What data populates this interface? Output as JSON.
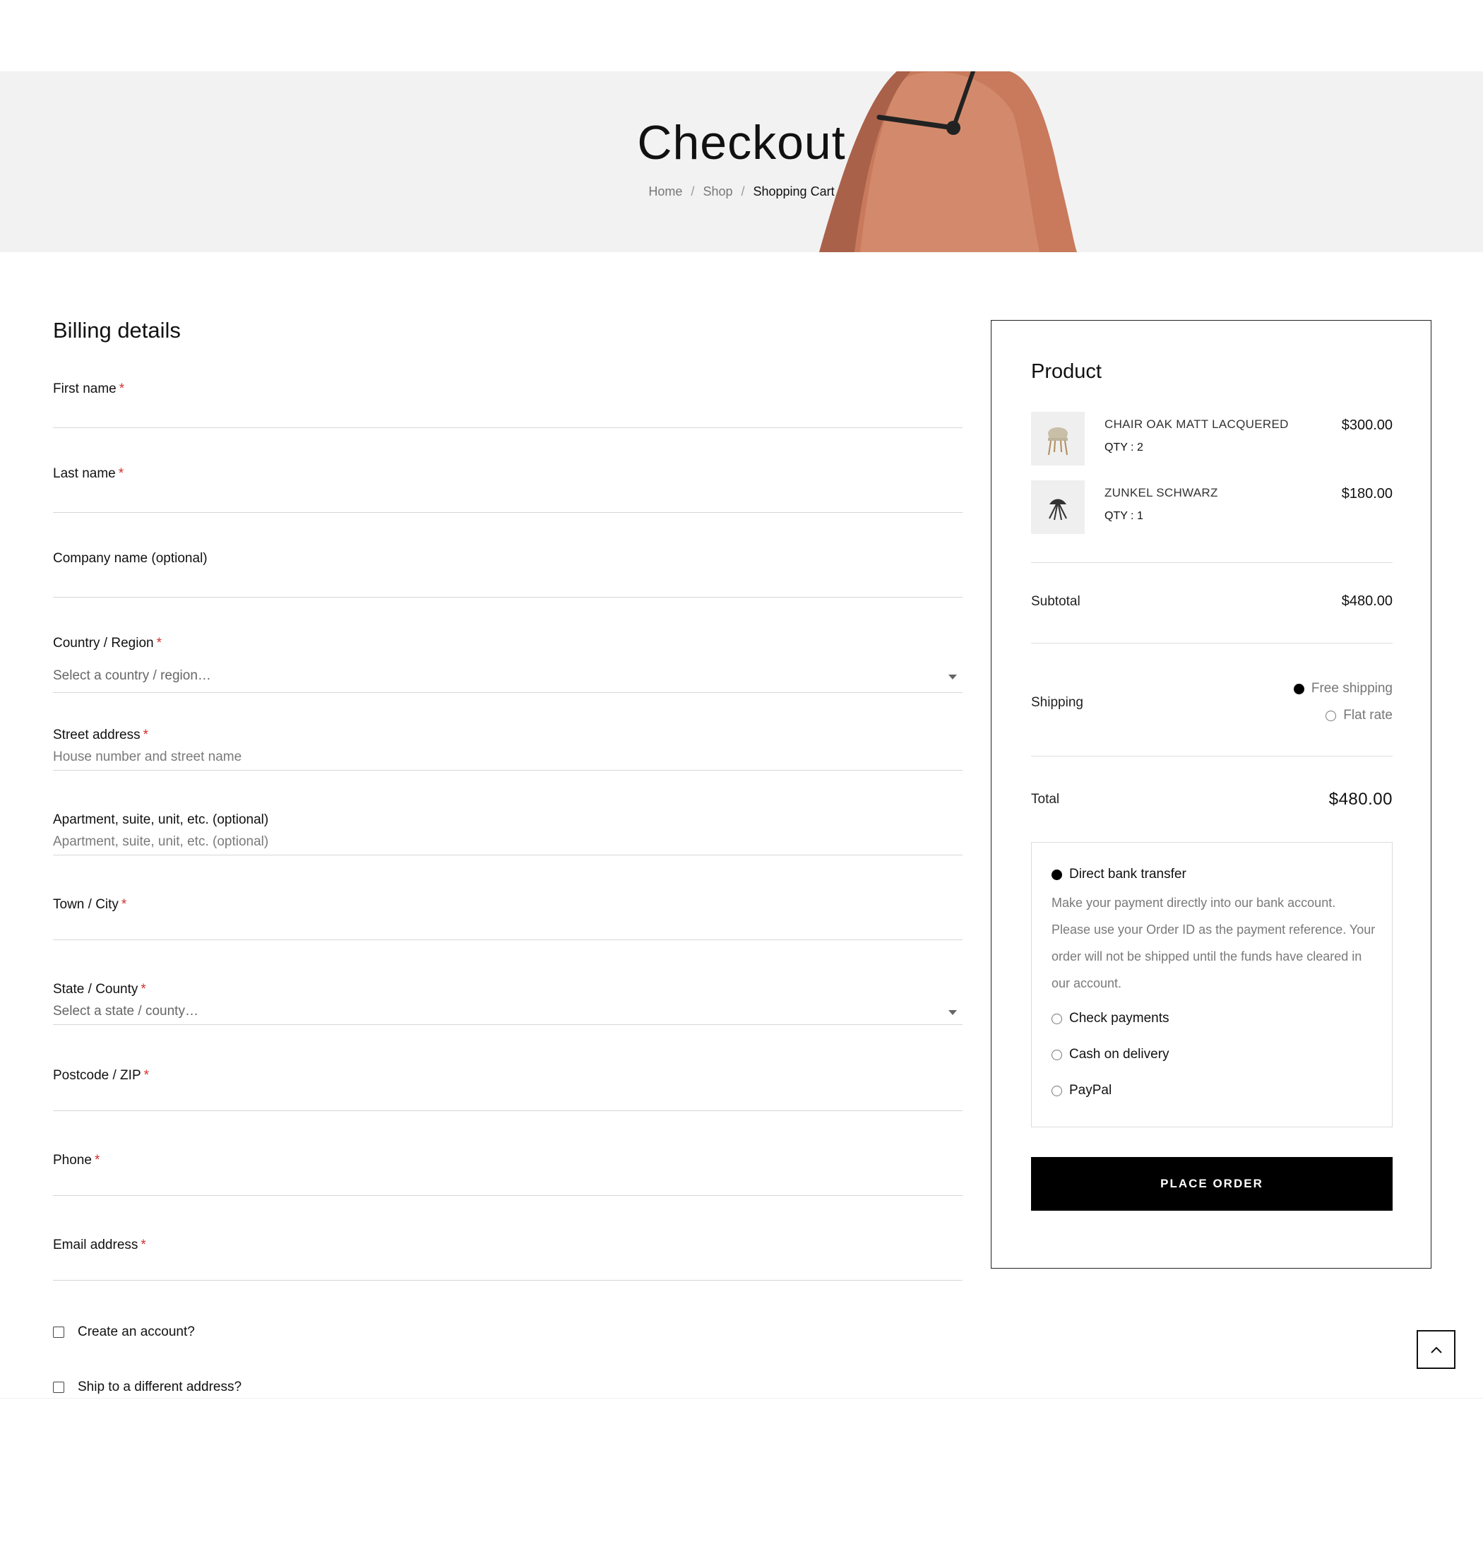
{
  "hero": {
    "title": "Checkout",
    "breadcrumb": [
      {
        "label": "Home"
      },
      {
        "label": "Shop"
      },
      {
        "label": "Shopping Cart"
      }
    ],
    "separator": "/"
  },
  "billing": {
    "heading": "Billing details",
    "fields": {
      "first_name": {
        "label": "First name",
        "required": "*",
        "value": ""
      },
      "last_name": {
        "label": "Last name",
        "required": "*",
        "value": ""
      },
      "company": {
        "label": "Company name (optional)",
        "value": ""
      },
      "country": {
        "label": "Country / Region",
        "required": "*",
        "selected": "Select a country / region…"
      },
      "street": {
        "label": "Street address",
        "required": "*",
        "placeholder": "House number and street name"
      },
      "apartment": {
        "label": "Apartment, suite, unit, etc. (optional)",
        "placeholder": "Apartment, suite, unit, etc. (optional)"
      },
      "city": {
        "label": "Town / City",
        "required": "*",
        "value": ""
      },
      "state": {
        "label": "State / County",
        "required": "*",
        "selected": "Select a state / county…"
      },
      "postcode": {
        "label": "Postcode / ZIP",
        "required": "*",
        "value": ""
      },
      "phone": {
        "label": "Phone",
        "required": "*",
        "value": ""
      },
      "email": {
        "label": "Email address",
        "required": "*",
        "value": ""
      }
    },
    "create_account": "Create an account?",
    "ship_different": "Ship to a different address?"
  },
  "order": {
    "heading": "Product",
    "items": [
      {
        "name": "CHAIR OAK MATT LACQUERED",
        "qty": "QTY : 2",
        "price": "$300.00",
        "icon": "chair-icon"
      },
      {
        "name": "ZUNKEL SCHWARZ",
        "qty": "QTY : 1",
        "price": "$180.00",
        "icon": "stool-icon"
      }
    ],
    "subtotal_label": "Subtotal",
    "subtotal_value": "$480.00",
    "shipping_label": "Shipping",
    "shipping_options": [
      {
        "label": "Free shipping",
        "selected": true
      },
      {
        "label": "Flat rate",
        "selected": false
      }
    ],
    "total_label": "Total",
    "total_value": "$480.00",
    "payment_methods": [
      {
        "label": "Direct bank transfer",
        "selected": true
      },
      {
        "label": "Check payments",
        "selected": false
      },
      {
        "label": "Cash on delivery",
        "selected": false
      },
      {
        "label": "PayPal",
        "selected": false
      }
    ],
    "bank_description": "Make your payment directly into our bank account. Please use your Order ID as the payment reference. Your order will not be shipped until the funds have cleared in our account.",
    "place_order": "PLACE ORDER"
  },
  "colors": {
    "hero_bg": "#f2f2f2",
    "clock": "#c97a5c",
    "required": "#d32f2f",
    "button_bg": "#000000"
  }
}
